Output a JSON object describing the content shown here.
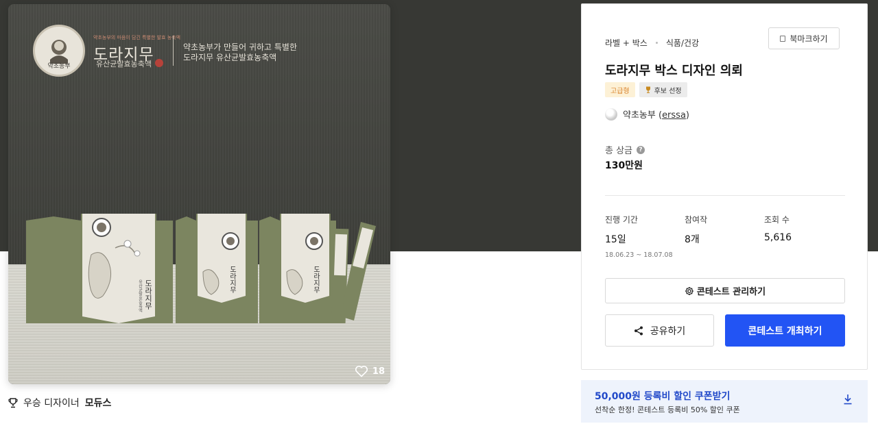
{
  "hero": {
    "brand_small": "약초농부의 마음이 담긴 특별한 발효 농축액",
    "brand_name": "도라지무",
    "brand_sub": "유산균발효농축액",
    "brand_tagline_1": "약초농부가 만들어 귀하고 특별한",
    "brand_tagline_2": "도라지무 유산균발효농축액",
    "emblem_text": "약초농부",
    "likes": "18",
    "heart_icon": "heart-outline-icon"
  },
  "winner": {
    "prefix": "우승 디자이너",
    "name": "모듀스",
    "icon": "trophy-icon"
  },
  "contest": {
    "category_1": "라벨 + 박스",
    "category_2": "식품/건강",
    "bookmark_label": "북마크하기",
    "title": "도라지무 박스 디자인 의뢰",
    "badge_tier": "고급형",
    "badge_candidate": "후보 선정",
    "client_name": "약초농부",
    "client_open": "(",
    "client_username": "erssa",
    "client_close": ")",
    "prize_label": "총 상금",
    "prize_value": "130만원",
    "stats": [
      {
        "label": "진행 기간",
        "value": "15일",
        "sub": "18.06.23 ~ 18.07.08"
      },
      {
        "label": "참여작",
        "value": "8개"
      },
      {
        "label": "조회 수",
        "value": "5,616"
      }
    ],
    "manage_label": "콘테스트 관리하기",
    "share_label": "공유하기",
    "host_label": "콘테스트 개최하기"
  },
  "coupon": {
    "title": "50,000원 등록비 할인 쿠폰받기",
    "desc": "선착순 한정! 콘테스트 등록비 50% 할인 쿠폰"
  },
  "colors": {
    "dark_band": "#373834",
    "primary": "#2254f4",
    "coupon_bg": "#eef3fc",
    "coupon_text": "#2149c9",
    "tier_badge_bg": "#fdf1d6",
    "tier_badge_text": "#d9822b"
  }
}
